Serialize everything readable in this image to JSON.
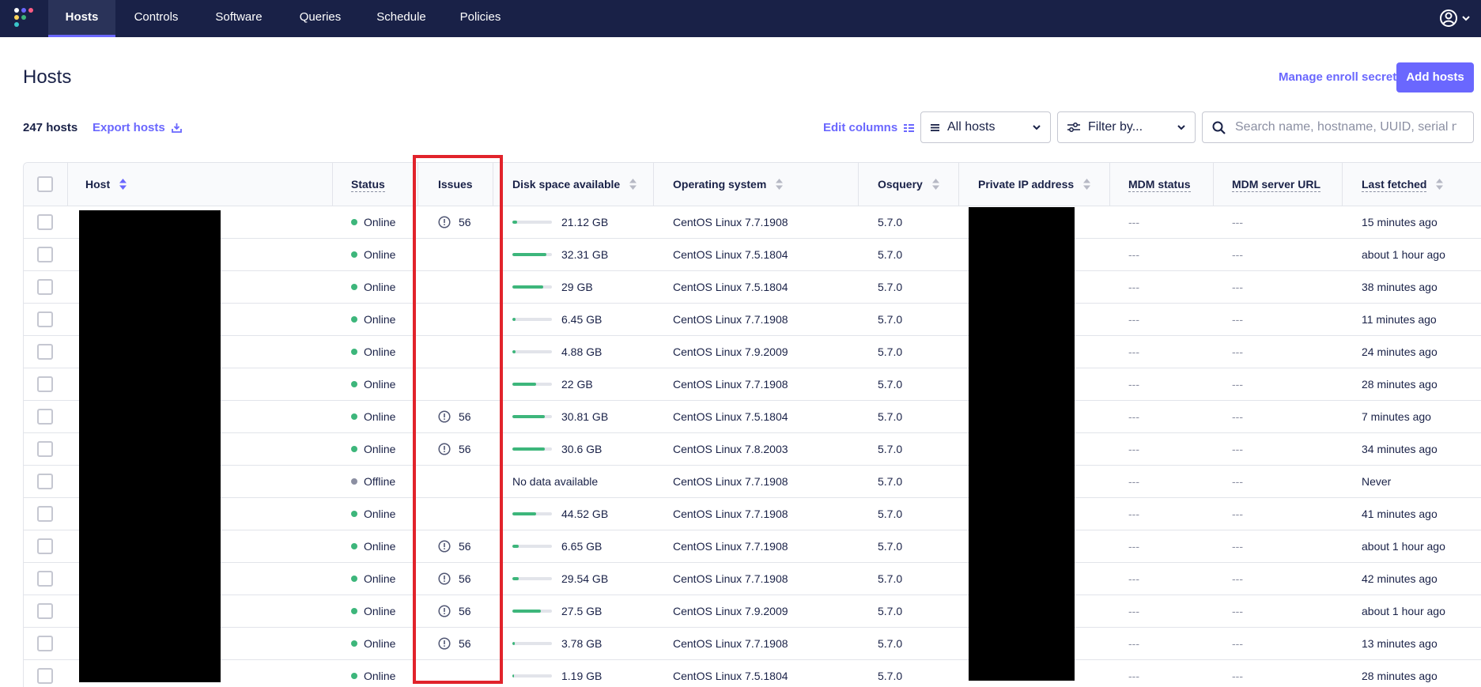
{
  "nav": {
    "items": [
      {
        "label": "Hosts",
        "active": true
      },
      {
        "label": "Controls",
        "active": false
      },
      {
        "label": "Software",
        "active": false
      },
      {
        "label": "Queries",
        "active": false
      },
      {
        "label": "Schedule",
        "active": false
      },
      {
        "label": "Policies",
        "active": false
      }
    ],
    "logo_icon": "fleet-logo-icon",
    "user_icon": "user-avatar-icon"
  },
  "header": {
    "title": "Hosts",
    "manage_enroll_secret": "Manage enroll secret",
    "add_hosts": "Add hosts"
  },
  "toolbar": {
    "hosts_count": "247 hosts",
    "export_hosts": "Export hosts",
    "edit_columns": "Edit columns",
    "all_hosts": "All hosts",
    "filter_by": "Filter by...",
    "search_placeholder": "Search name, hostname, UUID, serial number"
  },
  "table": {
    "columns": [
      "Host",
      "Status",
      "Issues",
      "Disk space available",
      "Operating system",
      "Osquery",
      "Private IP address",
      "MDM status",
      "MDM server URL",
      "Last fetched"
    ],
    "rows": [
      {
        "status": "Online",
        "issues": "56",
        "disk": "21.12 GB",
        "disk_pct": 0.12,
        "os": "CentOS Linux 7.7.1908",
        "osquery": "5.7.0",
        "mdm_status": "---",
        "mdm_url": "---",
        "last_fetched": "15 minutes ago"
      },
      {
        "status": "Online",
        "issues": "",
        "disk": "32.31 GB",
        "disk_pct": 0.85,
        "os": "CentOS Linux 7.5.1804",
        "osquery": "5.7.0",
        "mdm_status": "---",
        "mdm_url": "---",
        "last_fetched": "about 1 hour ago"
      },
      {
        "status": "Online",
        "issues": "",
        "disk": "29 GB",
        "disk_pct": 0.78,
        "os": "CentOS Linux 7.5.1804",
        "osquery": "5.7.0",
        "mdm_status": "---",
        "mdm_url": "---",
        "last_fetched": "38 minutes ago"
      },
      {
        "status": "Online",
        "issues": "",
        "disk": "6.45 GB",
        "disk_pct": 0.08,
        "os": "CentOS Linux 7.7.1908",
        "osquery": "5.7.0",
        "mdm_status": "---",
        "mdm_url": "---",
        "last_fetched": "11 minutes ago"
      },
      {
        "status": "Online",
        "issues": "",
        "disk": "4.88 GB",
        "disk_pct": 0.08,
        "os": "CentOS Linux 7.9.2009",
        "osquery": "5.7.0",
        "mdm_status": "---",
        "mdm_url": "---",
        "last_fetched": "24 minutes ago"
      },
      {
        "status": "Online",
        "issues": "",
        "disk": "22 GB",
        "disk_pct": 0.6,
        "os": "CentOS Linux 7.7.1908",
        "osquery": "5.7.0",
        "mdm_status": "---",
        "mdm_url": "---",
        "last_fetched": "28 minutes ago"
      },
      {
        "status": "Online",
        "issues": "56",
        "disk": "30.81 GB",
        "disk_pct": 0.82,
        "os": "CentOS Linux 7.5.1804",
        "osquery": "5.7.0",
        "mdm_status": "---",
        "mdm_url": "---",
        "last_fetched": "7 minutes ago"
      },
      {
        "status": "Online",
        "issues": "56",
        "disk": "30.6 GB",
        "disk_pct": 0.82,
        "os": "CentOS Linux 7.8.2003",
        "osquery": "5.7.0",
        "mdm_status": "---",
        "mdm_url": "---",
        "last_fetched": "34 minutes ago"
      },
      {
        "status": "Offline",
        "issues": "",
        "disk": "No data available",
        "disk_pct": null,
        "os": "CentOS Linux 7.7.1908",
        "osquery": "5.7.0",
        "mdm_status": "---",
        "mdm_url": "---",
        "last_fetched": "Never"
      },
      {
        "status": "Online",
        "issues": "",
        "disk": "44.52 GB",
        "disk_pct": 0.6,
        "os": "CentOS Linux 7.7.1908",
        "osquery": "5.7.0",
        "mdm_status": "---",
        "mdm_url": "---",
        "last_fetched": "41 minutes ago"
      },
      {
        "status": "Online",
        "issues": "56",
        "disk": "6.65 GB",
        "disk_pct": 0.15,
        "os": "CentOS Linux 7.7.1908",
        "osquery": "5.7.0",
        "mdm_status": "---",
        "mdm_url": "---",
        "last_fetched": "about 1 hour ago"
      },
      {
        "status": "Online",
        "issues": "56",
        "disk": "29.54 GB",
        "disk_pct": 0.15,
        "os": "CentOS Linux 7.7.1908",
        "osquery": "5.7.0",
        "mdm_status": "---",
        "mdm_url": "---",
        "last_fetched": "42 minutes ago"
      },
      {
        "status": "Online",
        "issues": "56",
        "disk": "27.5 GB",
        "disk_pct": 0.72,
        "os": "CentOS Linux 7.9.2009",
        "osquery": "5.7.0",
        "mdm_status": "---",
        "mdm_url": "---",
        "last_fetched": "about 1 hour ago"
      },
      {
        "status": "Online",
        "issues": "56",
        "disk": "3.78 GB",
        "disk_pct": 0.06,
        "os": "CentOS Linux 7.7.1908",
        "osquery": "5.7.0",
        "mdm_status": "---",
        "mdm_url": "---",
        "last_fetched": "13 minutes ago"
      },
      {
        "status": "Online",
        "issues": "",
        "disk": "1.19 GB",
        "disk_pct": 0.03,
        "os": "CentOS Linux 7.5.1804",
        "osquery": "5.7.0",
        "mdm_status": "---",
        "mdm_url": "---",
        "last_fetched": "28 minutes ago"
      }
    ]
  },
  "colors": {
    "nav_bg": "#192147",
    "accent": "#6a67fe",
    "online": "#3db67b",
    "offline": "#8b8fa2",
    "highlight": "#e1232b"
  }
}
